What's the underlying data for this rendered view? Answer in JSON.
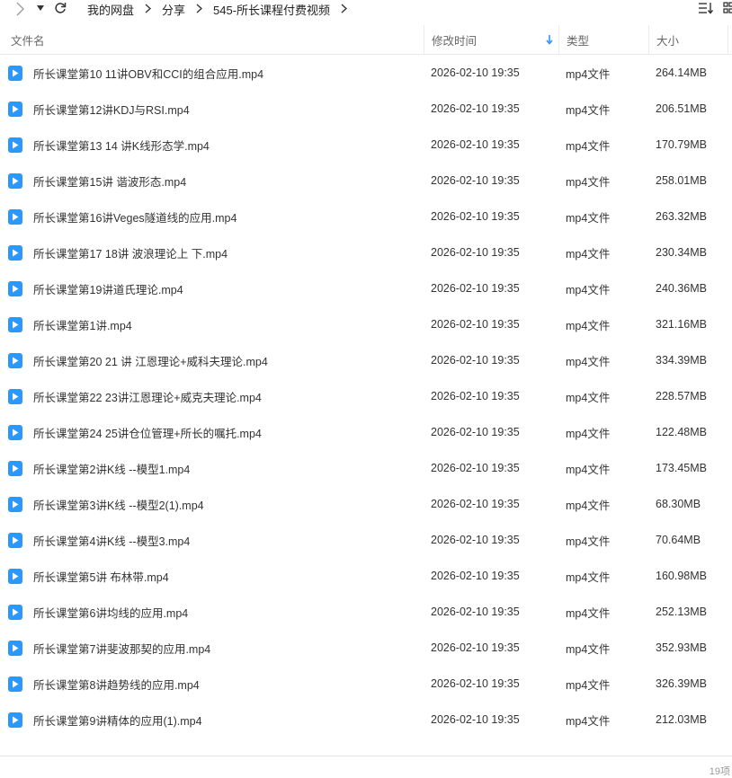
{
  "nav": {
    "breadcrumb": [
      "我的网盘",
      "分享",
      "545-所长课程付费视频"
    ]
  },
  "table": {
    "columns": {
      "name": "文件名",
      "modified": "修改时间",
      "type": "类型",
      "size": "大小"
    },
    "sort_column": "modified",
    "rows": [
      {
        "name": "所长课堂第10 11讲OBV和CCI的组合应用.mp4",
        "modified": "2026-02-10 19:35",
        "type": "mp4文件",
        "size": "264.14MB"
      },
      {
        "name": "所长课堂第12讲KDJ与RSI.mp4",
        "modified": "2026-02-10 19:35",
        "type": "mp4文件",
        "size": "206.51MB"
      },
      {
        "name": "所长课堂第13 14 讲K线形态学.mp4",
        "modified": "2026-02-10 19:35",
        "type": "mp4文件",
        "size": "170.79MB"
      },
      {
        "name": "所长课堂第15讲 谐波形态.mp4",
        "modified": "2026-02-10 19:35",
        "type": "mp4文件",
        "size": "258.01MB"
      },
      {
        "name": "所长课堂第16讲Veges隧道线的应用.mp4",
        "modified": "2026-02-10 19:35",
        "type": "mp4文件",
        "size": "263.32MB"
      },
      {
        "name": "所长课堂第17 18讲 波浪理论上  下.mp4",
        "modified": "2026-02-10 19:35",
        "type": "mp4文件",
        "size": "230.34MB"
      },
      {
        "name": "所长课堂第19讲道氏理论.mp4",
        "modified": "2026-02-10 19:35",
        "type": "mp4文件",
        "size": "240.36MB"
      },
      {
        "name": "所长课堂第1讲.mp4",
        "modified": "2026-02-10 19:35",
        "type": "mp4文件",
        "size": "321.16MB"
      },
      {
        "name": "所长课堂第20 21 讲 江恩理论+威科夫理论.mp4",
        "modified": "2026-02-10 19:35",
        "type": "mp4文件",
        "size": "334.39MB"
      },
      {
        "name": "所长课堂第22  23讲江恩理论+威克夫理论.mp4",
        "modified": "2026-02-10 19:35",
        "type": "mp4文件",
        "size": "228.57MB"
      },
      {
        "name": "所长课堂第24 25讲仓位管理+所长的嘱托.mp4",
        "modified": "2026-02-10 19:35",
        "type": "mp4文件",
        "size": "122.48MB"
      },
      {
        "name": "所长课堂第2讲K线 --模型1.mp4",
        "modified": "2026-02-10 19:35",
        "type": "mp4文件",
        "size": "173.45MB"
      },
      {
        "name": "所长课堂第3讲K线 --模型2(1).mp4",
        "modified": "2026-02-10 19:35",
        "type": "mp4文件",
        "size": "68.30MB"
      },
      {
        "name": "所长课堂第4讲K线 --模型3.mp4",
        "modified": "2026-02-10 19:35",
        "type": "mp4文件",
        "size": "70.64MB"
      },
      {
        "name": "所长课堂第5讲 布林带.mp4",
        "modified": "2026-02-10 19:35",
        "type": "mp4文件",
        "size": "160.98MB"
      },
      {
        "name": "所长课堂第6讲均线的应用.mp4",
        "modified": "2026-02-10 19:35",
        "type": "mp4文件",
        "size": "252.13MB"
      },
      {
        "name": "所长课堂第7讲斐波那契的应用.mp4",
        "modified": "2026-02-10 19:35",
        "type": "mp4文件",
        "size": "352.93MB"
      },
      {
        "name": "所长课堂第8讲趋势线的应用.mp4",
        "modified": "2026-02-10 19:35",
        "type": "mp4文件",
        "size": "326.39MB"
      },
      {
        "name": "所长课堂第9讲精体的应用(1).mp4",
        "modified": "2026-02-10 19:35",
        "type": "mp4文件",
        "size": "212.03MB"
      }
    ]
  },
  "footer": {
    "count": "19项"
  },
  "icons": {
    "file": "video-file-icon",
    "forward": "chevron-right-icon",
    "dropdown": "caret-down-icon",
    "refresh": "refresh-icon",
    "list_view": "list-view-icon",
    "grid_view": "grid-view-icon",
    "sort": "sort-down-arrow-icon"
  },
  "colors": {
    "file_icon": "#2d96ff",
    "sort_arrow": "#2d96ff"
  }
}
